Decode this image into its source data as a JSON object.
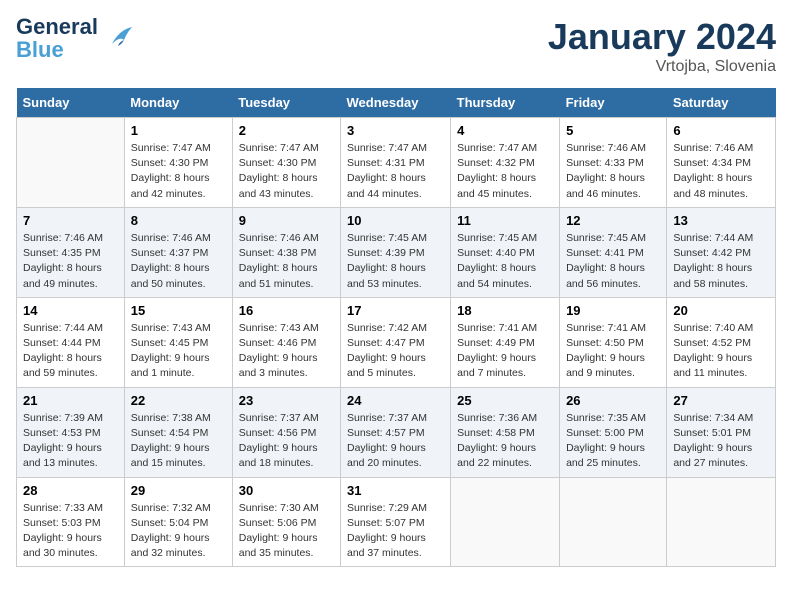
{
  "header": {
    "logo_line1": "General",
    "logo_line2": "Blue",
    "month": "January 2024",
    "location": "Vrtojba, Slovenia"
  },
  "weekdays": [
    "Sunday",
    "Monday",
    "Tuesday",
    "Wednesday",
    "Thursday",
    "Friday",
    "Saturday"
  ],
  "weeks": [
    [
      {
        "day": "",
        "info": ""
      },
      {
        "day": "1",
        "info": "Sunrise: 7:47 AM\nSunset: 4:30 PM\nDaylight: 8 hours\nand 42 minutes."
      },
      {
        "day": "2",
        "info": "Sunrise: 7:47 AM\nSunset: 4:30 PM\nDaylight: 8 hours\nand 43 minutes."
      },
      {
        "day": "3",
        "info": "Sunrise: 7:47 AM\nSunset: 4:31 PM\nDaylight: 8 hours\nand 44 minutes."
      },
      {
        "day": "4",
        "info": "Sunrise: 7:47 AM\nSunset: 4:32 PM\nDaylight: 8 hours\nand 45 minutes."
      },
      {
        "day": "5",
        "info": "Sunrise: 7:46 AM\nSunset: 4:33 PM\nDaylight: 8 hours\nand 46 minutes."
      },
      {
        "day": "6",
        "info": "Sunrise: 7:46 AM\nSunset: 4:34 PM\nDaylight: 8 hours\nand 48 minutes."
      }
    ],
    [
      {
        "day": "7",
        "info": "Sunrise: 7:46 AM\nSunset: 4:35 PM\nDaylight: 8 hours\nand 49 minutes."
      },
      {
        "day": "8",
        "info": "Sunrise: 7:46 AM\nSunset: 4:37 PM\nDaylight: 8 hours\nand 50 minutes."
      },
      {
        "day": "9",
        "info": "Sunrise: 7:46 AM\nSunset: 4:38 PM\nDaylight: 8 hours\nand 51 minutes."
      },
      {
        "day": "10",
        "info": "Sunrise: 7:45 AM\nSunset: 4:39 PM\nDaylight: 8 hours\nand 53 minutes."
      },
      {
        "day": "11",
        "info": "Sunrise: 7:45 AM\nSunset: 4:40 PM\nDaylight: 8 hours\nand 54 minutes."
      },
      {
        "day": "12",
        "info": "Sunrise: 7:45 AM\nSunset: 4:41 PM\nDaylight: 8 hours\nand 56 minutes."
      },
      {
        "day": "13",
        "info": "Sunrise: 7:44 AM\nSunset: 4:42 PM\nDaylight: 8 hours\nand 58 minutes."
      }
    ],
    [
      {
        "day": "14",
        "info": "Sunrise: 7:44 AM\nSunset: 4:44 PM\nDaylight: 8 hours\nand 59 minutes."
      },
      {
        "day": "15",
        "info": "Sunrise: 7:43 AM\nSunset: 4:45 PM\nDaylight: 9 hours\nand 1 minute."
      },
      {
        "day": "16",
        "info": "Sunrise: 7:43 AM\nSunset: 4:46 PM\nDaylight: 9 hours\nand 3 minutes."
      },
      {
        "day": "17",
        "info": "Sunrise: 7:42 AM\nSunset: 4:47 PM\nDaylight: 9 hours\nand 5 minutes."
      },
      {
        "day": "18",
        "info": "Sunrise: 7:41 AM\nSunset: 4:49 PM\nDaylight: 9 hours\nand 7 minutes."
      },
      {
        "day": "19",
        "info": "Sunrise: 7:41 AM\nSunset: 4:50 PM\nDaylight: 9 hours\nand 9 minutes."
      },
      {
        "day": "20",
        "info": "Sunrise: 7:40 AM\nSunset: 4:52 PM\nDaylight: 9 hours\nand 11 minutes."
      }
    ],
    [
      {
        "day": "21",
        "info": "Sunrise: 7:39 AM\nSunset: 4:53 PM\nDaylight: 9 hours\nand 13 minutes."
      },
      {
        "day": "22",
        "info": "Sunrise: 7:38 AM\nSunset: 4:54 PM\nDaylight: 9 hours\nand 15 minutes."
      },
      {
        "day": "23",
        "info": "Sunrise: 7:37 AM\nSunset: 4:56 PM\nDaylight: 9 hours\nand 18 minutes."
      },
      {
        "day": "24",
        "info": "Sunrise: 7:37 AM\nSunset: 4:57 PM\nDaylight: 9 hours\nand 20 minutes."
      },
      {
        "day": "25",
        "info": "Sunrise: 7:36 AM\nSunset: 4:58 PM\nDaylight: 9 hours\nand 22 minutes."
      },
      {
        "day": "26",
        "info": "Sunrise: 7:35 AM\nSunset: 5:00 PM\nDaylight: 9 hours\nand 25 minutes."
      },
      {
        "day": "27",
        "info": "Sunrise: 7:34 AM\nSunset: 5:01 PM\nDaylight: 9 hours\nand 27 minutes."
      }
    ],
    [
      {
        "day": "28",
        "info": "Sunrise: 7:33 AM\nSunset: 5:03 PM\nDaylight: 9 hours\nand 30 minutes."
      },
      {
        "day": "29",
        "info": "Sunrise: 7:32 AM\nSunset: 5:04 PM\nDaylight: 9 hours\nand 32 minutes."
      },
      {
        "day": "30",
        "info": "Sunrise: 7:30 AM\nSunset: 5:06 PM\nDaylight: 9 hours\nand 35 minutes."
      },
      {
        "day": "31",
        "info": "Sunrise: 7:29 AM\nSunset: 5:07 PM\nDaylight: 9 hours\nand 37 minutes."
      },
      {
        "day": "",
        "info": ""
      },
      {
        "day": "",
        "info": ""
      },
      {
        "day": "",
        "info": ""
      }
    ]
  ]
}
